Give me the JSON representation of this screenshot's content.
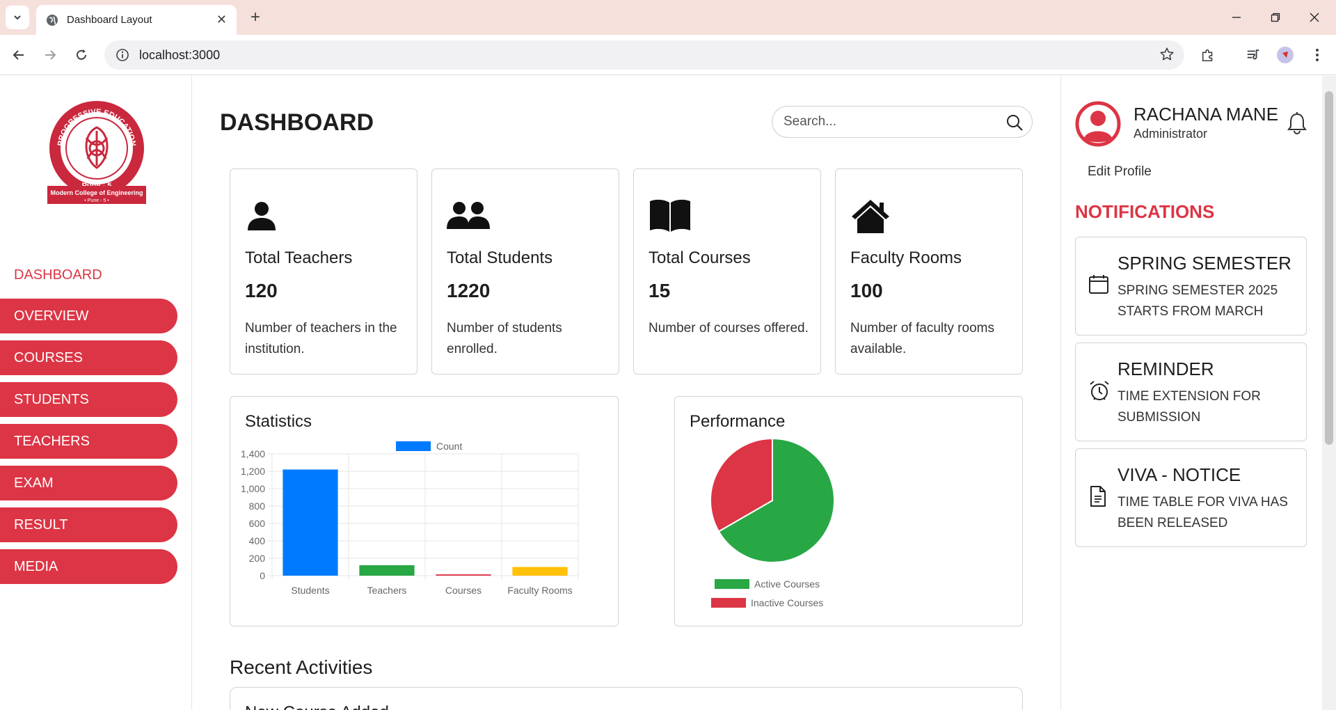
{
  "browser": {
    "tab_title": "Dashboard Layout",
    "url": "localhost:3000"
  },
  "sidebar": {
    "logo": {
      "arc_text": "PROGRESSIVE EDUCATION SOCIETY",
      "top_text": "ज्ञानमयो भव",
      "pune": "Pune - 5",
      "college": "Modern College of Engineering",
      "college_sub": "• Pune - 5 •"
    },
    "heading": "DASHBOARD",
    "items": [
      {
        "label": "OVERVIEW"
      },
      {
        "label": "COURSES"
      },
      {
        "label": "STUDENTS"
      },
      {
        "label": "TEACHERS"
      },
      {
        "label": "EXAM"
      },
      {
        "label": "RESULT"
      },
      {
        "label": "MEDIA"
      }
    ]
  },
  "main": {
    "title": "DASHBOARD",
    "search_placeholder": "Search...",
    "cards": [
      {
        "title": "Total Teachers",
        "value": "120",
        "desc": "Number of teachers in the institution.",
        "icon": "person-icon"
      },
      {
        "title": "Total Students",
        "value": "1220",
        "desc": "Number of students enrolled.",
        "icon": "people-icon"
      },
      {
        "title": "Total Courses",
        "value": "15",
        "desc": "Number of courses offered.",
        "icon": "book-icon"
      },
      {
        "title": "Faculty Rooms",
        "value": "100",
        "desc": "Number of faculty rooms available.",
        "icon": "house-icon"
      }
    ],
    "statistics_title": "Statistics",
    "performance_title": "Performance",
    "recent_title": "Recent Activities",
    "recent_first": "New Course Added"
  },
  "chart_data": [
    {
      "type": "bar",
      "categories": [
        "Students",
        "Teachers",
        "Courses",
        "Faculty Rooms"
      ],
      "series": [
        {
          "name": "Count",
          "values": [
            1220,
            120,
            15,
            100
          ]
        }
      ],
      "colors": [
        "#007bff",
        "#28a745",
        "#dc3545",
        "#ffc107"
      ],
      "ylim": [
        0,
        1400
      ],
      "yticks": [
        0,
        200,
        400,
        600,
        800,
        1000,
        1200,
        1400
      ],
      "ytick_labels": [
        "0",
        "200",
        "400",
        "600",
        "800",
        "1,000",
        "1,200",
        "1,400"
      ],
      "legend": "top",
      "grid": true
    },
    {
      "type": "pie",
      "labels": [
        "Active Courses",
        "Inactive Courses"
      ],
      "values": [
        10,
        5
      ],
      "colors": [
        "#28a745",
        "#dc3545"
      ],
      "legend": "bottom"
    }
  ],
  "profile": {
    "name": "RACHANA MANE",
    "role": "Administrator",
    "edit_label": "Edit Profile"
  },
  "notifications": {
    "heading": "NOTIFICATIONS",
    "items": [
      {
        "title": "SPRING SEMESTER",
        "text": "SPRING SEMESTER 2025 STARTS FROM MARCH",
        "icon": "calendar-icon"
      },
      {
        "title": "REMINDER",
        "text": "TIME EXTENSION FOR SUBMISSION",
        "icon": "alarm-clock-icon"
      },
      {
        "title": "VIVA - NOTICE",
        "text": "TIME TABLE FOR VIVA HAS BEEN RELEASED",
        "icon": "document-icon"
      }
    ]
  },
  "colors": {
    "accent": "#dc3545",
    "tabbar": "#f6e0db"
  }
}
